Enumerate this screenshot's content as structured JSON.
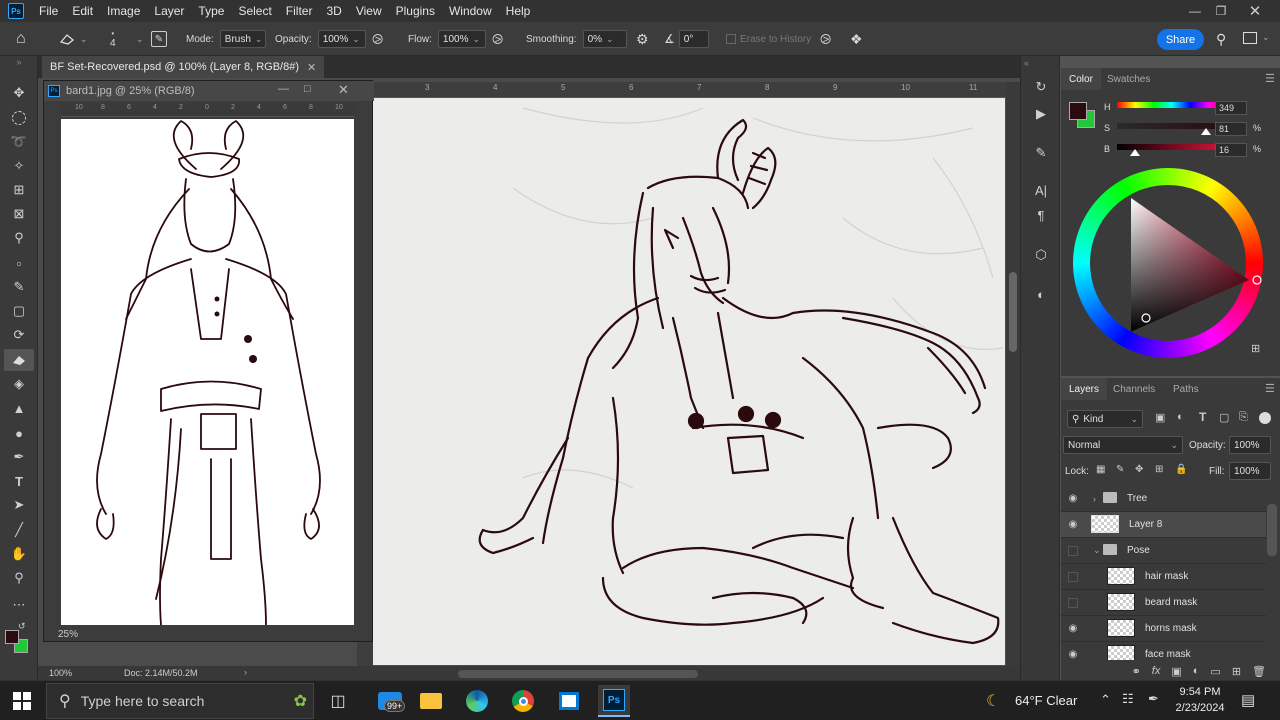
{
  "menu": [
    "File",
    "Edit",
    "Image",
    "Layer",
    "Type",
    "Select",
    "Filter",
    "3D",
    "View",
    "Plugins",
    "Window",
    "Help"
  ],
  "options": {
    "brush_size": "4",
    "mode_label": "Mode:",
    "mode_value": "Brush",
    "opacity_label": "Opacity:",
    "opacity_value": "100%",
    "flow_label": "Flow:",
    "flow_value": "100%",
    "smoothing_label": "Smoothing:",
    "smoothing_value": "0%",
    "angle_value": "0°",
    "erase_history_label": "Erase to History",
    "share_label": "Share"
  },
  "document": {
    "tab_title": "BF Set-Recovered.psd @ 100% (Layer 8, RGB/8#)",
    "zoom": "100%",
    "doc_size": "Doc: 2.14M/50.2M",
    "ruler_marks": [
      "3",
      "4",
      "5",
      "6",
      "7",
      "8",
      "9",
      "10",
      "11"
    ]
  },
  "floating_window": {
    "title": "bard1.jpg @ 25% (RGB/8)",
    "zoom": "25%",
    "ruler_marks": [
      "10",
      "8",
      "6",
      "4",
      "2",
      "0",
      "2",
      "4",
      "6",
      "8",
      "10"
    ]
  },
  "color_panel": {
    "tabs": [
      "Color",
      "Swatches"
    ],
    "h_label": "H",
    "h_value": "349",
    "h_fraction": 0.97,
    "s_label": "S",
    "s_value": "81",
    "s_fraction": 0.81,
    "b_label": "B",
    "b_value": "16",
    "b_fraction": 0.16,
    "unit": "%",
    "foreground": "#2a0b0f",
    "background": "#22c83a"
  },
  "layers_panel": {
    "tabs": [
      "Layers",
      "Channels",
      "Paths"
    ],
    "kind_label": "Kind",
    "blend_mode": "Normal",
    "opacity_label": "Opacity:",
    "opacity_value": "100%",
    "lock_label": "Lock:",
    "fill_label": "Fill:",
    "fill_value": "100%",
    "layers": [
      {
        "name": "Tree",
        "type": "group",
        "visible": true,
        "expanded": false,
        "indent": 0
      },
      {
        "name": "Layer 8",
        "type": "layer",
        "visible": true,
        "selected": true,
        "indent": 0
      },
      {
        "name": "Pose",
        "type": "group",
        "visible": false,
        "expanded": true,
        "indent": 0
      },
      {
        "name": "hair mask",
        "type": "layer",
        "visible": false,
        "indent": 1
      },
      {
        "name": "beard mask",
        "type": "layer",
        "visible": false,
        "indent": 1
      },
      {
        "name": "horns mask",
        "type": "layer",
        "visible": true,
        "indent": 1
      },
      {
        "name": "face mask",
        "type": "layer",
        "visible": true,
        "indent": 1
      }
    ]
  },
  "taskbar": {
    "search_placeholder": "Type here to search",
    "mail_badge": "99+",
    "weather": "64°F  Clear",
    "time": "9:54 PM",
    "date": "2/23/2024"
  }
}
